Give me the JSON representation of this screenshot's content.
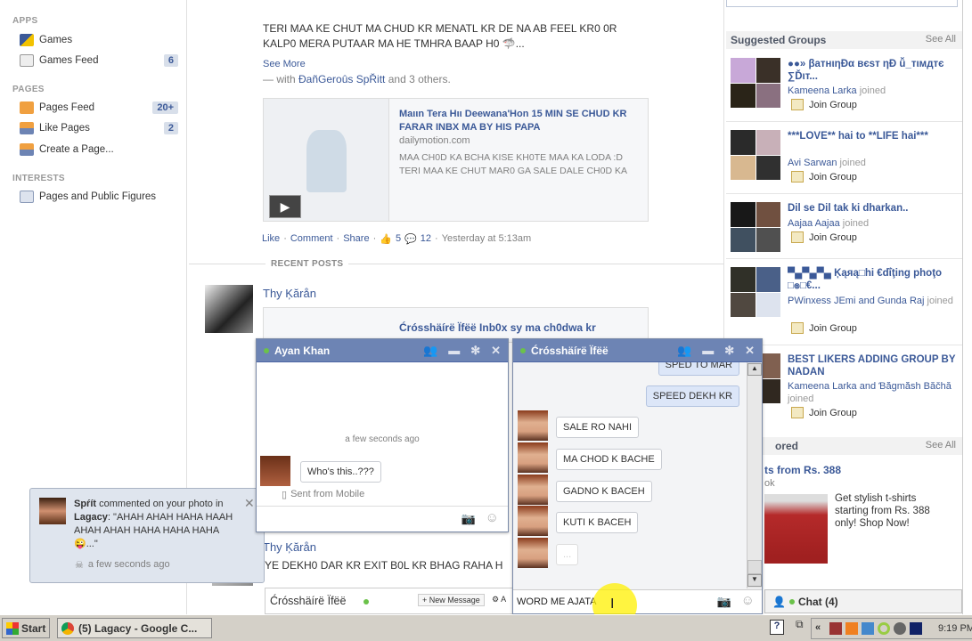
{
  "sidebar": {
    "apps_heading": "APPS",
    "games": "Games",
    "games_feed": "Games Feed",
    "games_feed_count": "6",
    "pages_heading": "PAGES",
    "pages_feed": "Pages Feed",
    "pages_feed_count": "20+",
    "like_pages": "Like Pages",
    "like_pages_count": "2",
    "create_page": "Create a Page...",
    "interests_heading": "INTERESTS",
    "public_figures": "Pages and Public Figures"
  },
  "post": {
    "text_line1": "TERI MAA KE CHUT MA CHUD KR MENATL KR DE NA AB FEEL KR0 0R",
    "text_line2": "KALP0 MERA PUTAAR MA HE TMHRA BAAP H0 🦈...",
    "see_more": "See More",
    "with_prefix": "— with ",
    "with_name": "ĐañGeroûs SpŘitt",
    "with_suffix": " and 3 others.",
    "link_title": "Maιιn Tera Hιι Deewana'Hon 15 MIN SE CHUD KR FARAR INBX MA BY HIS PAPA",
    "link_domain": "dailymotion.com",
    "link_desc": "MAA CH0D KA BCHA KISE KH0TE MAA KA LODA :D TERI MAA KE CHUT MAR0 GA SALE DALE CH0D KA",
    "like": "Like",
    "comment": "Comment",
    "share": "Share",
    "likes": "5",
    "comments": "12",
    "time": "Yesterday at 5:13am"
  },
  "recent": {
    "heading": "RECENT POSTS",
    "author": "Thy Ķărån",
    "link_title": "Ćrósshäírë Ïfëë Inb0x sy ma ch0dwa kr",
    "author2": "Thy Ķărån",
    "text2": "YE DEKH0 DAR KR EXIT B0L KR BHAG RAHA H"
  },
  "groups": {
    "heading": "Suggested Groups",
    "see_all": "See All",
    "join": "Join Group",
    "items": [
      {
        "title": "●●» βатнιηÐα вєѕт ηÐ ǚ_тιмдтє ∑Ďιт...",
        "joined_name": "Kameena Larka",
        "joined": " joined"
      },
      {
        "title": "***LOVE** hai to **LIFE hai***",
        "joined_name": "Avi Sarwan",
        "joined": " joined"
      },
      {
        "title": "Dil se Dil tak ki dharkan..",
        "joined_name": "Aajaa Aajaa",
        "joined": " joined"
      },
      {
        "title": "▀▄▀▄▀▄ Ķąяą□hi €dΐţing phoţo □๏□€...",
        "joined_name": "PWinxess JEmi and Gunda Raj",
        "joined": " joined"
      },
      {
        "title": "BEST LIKERS ADDING GROUP BY NADAN",
        "joined_name": "Kameena Larka and Ɓă̌gmă̌sh Băčhă",
        "joined": " joined"
      }
    ]
  },
  "sponsored": {
    "heading": "ored",
    "see_all": "See All",
    "ad_title": "ts from Rs. 388",
    "ad_sub": "ok",
    "ad_text": "Get stylish t-shirts starting from Rs. 388 only! Shop Now!"
  },
  "chat_ayan": {
    "name": "Ayan Khan",
    "timestamp": "a few seconds ago",
    "message": "Who's this..???",
    "sent_from": "Sent from Mobile"
  },
  "chat_cross": {
    "name": "Ćrósshäírë Ïfëë",
    "messages_me": [
      "SPED TO MAR",
      "SPEED DEKH KR"
    ],
    "messages_them": [
      "SALE RO NAHI",
      "MA CHOD K BACHE",
      "GADNO K BACEH",
      "KUTI K BACEH",
      "..."
    ],
    "input_value": "WORD ME AJATA"
  },
  "chat_tab": {
    "name": "Ćrósshäírë Ïfëë",
    "new_message": "+ New Message",
    "actions": "⚙ A"
  },
  "chat_bar": {
    "label": "Chat (4)"
  },
  "notification": {
    "user": "Spŕít",
    "text": " commented on your photo in ",
    "page": "Lagacy",
    "quote": ": \"AHAH AHAH HAHA HAAH AHAH AHAH HAHA HAHA HAHA 😜...\"",
    "time": "a few seconds ago"
  },
  "taskbar": {
    "start": "Start",
    "window": "(5) Lagacy - Google C...",
    "clock": "9:19 PM",
    "chevron": "«"
  }
}
